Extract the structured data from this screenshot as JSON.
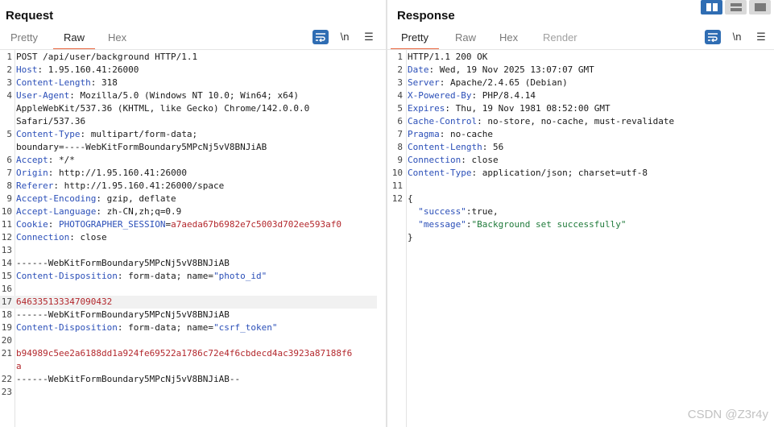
{
  "request": {
    "title": "Request",
    "tabs": [
      "Pretty",
      "Raw",
      "Hex"
    ],
    "active_tab": "Raw",
    "newline_btn": "\\n",
    "lines": [
      {
        "n": "1",
        "parts": [
          {
            "t": "POST /api/user/background HTTP/1.1"
          }
        ]
      },
      {
        "n": "2",
        "parts": [
          {
            "t": "Host",
            "c": "hn"
          },
          {
            "t": ": 1.95.160.41:26000"
          }
        ]
      },
      {
        "n": "3",
        "parts": [
          {
            "t": "Content-Length",
            "c": "hn"
          },
          {
            "t": ": 318"
          }
        ]
      },
      {
        "n": "4",
        "parts": [
          {
            "t": "User-Agent",
            "c": "hn"
          },
          {
            "t": ": Mozilla/5.0 (Windows NT 10.0; Win64; x64)"
          }
        ]
      },
      {
        "n": "",
        "parts": [
          {
            "t": "AppleWebKit/537.36 (KHTML, like Gecko) Chrome/142.0.0.0"
          }
        ]
      },
      {
        "n": "",
        "parts": [
          {
            "t": "Safari/537.36"
          }
        ]
      },
      {
        "n": "5",
        "parts": [
          {
            "t": "Content-Type",
            "c": "hn"
          },
          {
            "t": ": multipart/form-data;"
          }
        ]
      },
      {
        "n": "",
        "parts": [
          {
            "t": "boundary=----WebKitFormBoundary5MPcNj5vV8BNJiAB"
          }
        ]
      },
      {
        "n": "6",
        "parts": [
          {
            "t": "Accept",
            "c": "hn"
          },
          {
            "t": ": */*"
          }
        ]
      },
      {
        "n": "7",
        "parts": [
          {
            "t": "Origin",
            "c": "hn"
          },
          {
            "t": ": http://1.95.160.41:26000"
          }
        ]
      },
      {
        "n": "8",
        "parts": [
          {
            "t": "Referer",
            "c": "hn"
          },
          {
            "t": ": http://1.95.160.41:26000/space"
          }
        ]
      },
      {
        "n": "9",
        "parts": [
          {
            "t": "Accept-Encoding",
            "c": "hn"
          },
          {
            "t": ": gzip, deflate"
          }
        ]
      },
      {
        "n": "10",
        "parts": [
          {
            "t": "Accept-Language",
            "c": "hn"
          },
          {
            "t": ": zh-CN,zh;q=0.9"
          }
        ]
      },
      {
        "n": "11",
        "parts": [
          {
            "t": "Cookie",
            "c": "hn"
          },
          {
            "t": ": "
          },
          {
            "t": "PHOTOGRAPHER_SESSION",
            "c": "hn"
          },
          {
            "t": "="
          },
          {
            "t": "a7aeda67b6982e7c5003d702ee593af0",
            "c": "red"
          }
        ]
      },
      {
        "n": "12",
        "parts": [
          {
            "t": "Connection",
            "c": "hn"
          },
          {
            "t": ": close"
          }
        ]
      },
      {
        "n": "13",
        "parts": []
      },
      {
        "n": "14",
        "parts": [
          {
            "t": "------WebKitFormBoundary5MPcNj5vV8BNJiAB"
          }
        ]
      },
      {
        "n": "15",
        "parts": [
          {
            "t": "Content-Disposition",
            "c": "hn"
          },
          {
            "t": ": form-data; name="
          },
          {
            "t": "\"photo_id\"",
            "c": "hn"
          }
        ]
      },
      {
        "n": "16",
        "parts": []
      },
      {
        "n": "17",
        "hl": true,
        "parts": [
          {
            "t": "646335133347090432",
            "c": "red"
          }
        ]
      },
      {
        "n": "18",
        "parts": [
          {
            "t": "------WebKitFormBoundary5MPcNj5vV8BNJiAB"
          }
        ]
      },
      {
        "n": "19",
        "parts": [
          {
            "t": "Content-Disposition",
            "c": "hn"
          },
          {
            "t": ": form-data; name="
          },
          {
            "t": "\"csrf_token\"",
            "c": "hn"
          }
        ]
      },
      {
        "n": "20",
        "parts": []
      },
      {
        "n": "21",
        "parts": [
          {
            "t": "b94989c5ee2a6188dd1a924fe69522a1786c72e4f6cbdecd4ac3923a87188f6",
            "c": "red"
          }
        ]
      },
      {
        "n": "",
        "parts": [
          {
            "t": "a",
            "c": "red"
          }
        ]
      },
      {
        "n": "22",
        "parts": [
          {
            "t": "------WebKitFormBoundary5MPcNj5vV8BNJiAB--"
          }
        ]
      },
      {
        "n": "23",
        "parts": []
      }
    ]
  },
  "response": {
    "title": "Response",
    "tabs": [
      "Pretty",
      "Raw",
      "Hex",
      "Render"
    ],
    "active_tab": "Pretty",
    "newline_btn": "\\n",
    "lines": [
      {
        "n": "1",
        "parts": [
          {
            "t": "HTTP/1.1 200 OK"
          }
        ]
      },
      {
        "n": "2",
        "parts": [
          {
            "t": "Date",
            "c": "hn"
          },
          {
            "t": ": Wed, 19 Nov 2025 13:07:07 GMT"
          }
        ]
      },
      {
        "n": "3",
        "parts": [
          {
            "t": "Server",
            "c": "hn"
          },
          {
            "t": ": Apache/2.4.65 (Debian)"
          }
        ]
      },
      {
        "n": "4",
        "parts": [
          {
            "t": "X-Powered-By",
            "c": "hn"
          },
          {
            "t": ": PHP/8.4.14"
          }
        ]
      },
      {
        "n": "5",
        "parts": [
          {
            "t": "Expires",
            "c": "hn"
          },
          {
            "t": ": Thu, 19 Nov 1981 08:52:00 GMT"
          }
        ]
      },
      {
        "n": "6",
        "parts": [
          {
            "t": "Cache-Control",
            "c": "hn"
          },
          {
            "t": ": no-store, no-cache, must-revalidate"
          }
        ]
      },
      {
        "n": "7",
        "parts": [
          {
            "t": "Pragma",
            "c": "hn"
          },
          {
            "t": ": no-cache"
          }
        ]
      },
      {
        "n": "8",
        "parts": [
          {
            "t": "Content-Length",
            "c": "hn"
          },
          {
            "t": ": 56"
          }
        ]
      },
      {
        "n": "9",
        "parts": [
          {
            "t": "Connection",
            "c": "hn"
          },
          {
            "t": ": close"
          }
        ]
      },
      {
        "n": "10",
        "parts": [
          {
            "t": "Content-Type",
            "c": "hn"
          },
          {
            "t": ": application/json; charset=utf-8"
          }
        ]
      },
      {
        "n": "11",
        "parts": []
      },
      {
        "n": "12",
        "parts": [
          {
            "t": "{"
          }
        ]
      },
      {
        "n": "",
        "parts": [
          {
            "t": "  "
          },
          {
            "t": "\"success\"",
            "c": "jk"
          },
          {
            "t": ":true,"
          }
        ]
      },
      {
        "n": "",
        "parts": [
          {
            "t": "  "
          },
          {
            "t": "\"message\"",
            "c": "jk"
          },
          {
            "t": ":"
          },
          {
            "t": "\"Background set successfully\"",
            "c": "js"
          }
        ]
      },
      {
        "n": "",
        "parts": [
          {
            "t": "}"
          }
        ]
      }
    ]
  },
  "watermark": "CSDN @Z3r4y",
  "colors": {
    "accent": "#e8633b",
    "header_name": "#2b4fb8",
    "value_red": "#b3282d",
    "json_string": "#1f7a3a",
    "button_blue": "#2f6db3"
  }
}
